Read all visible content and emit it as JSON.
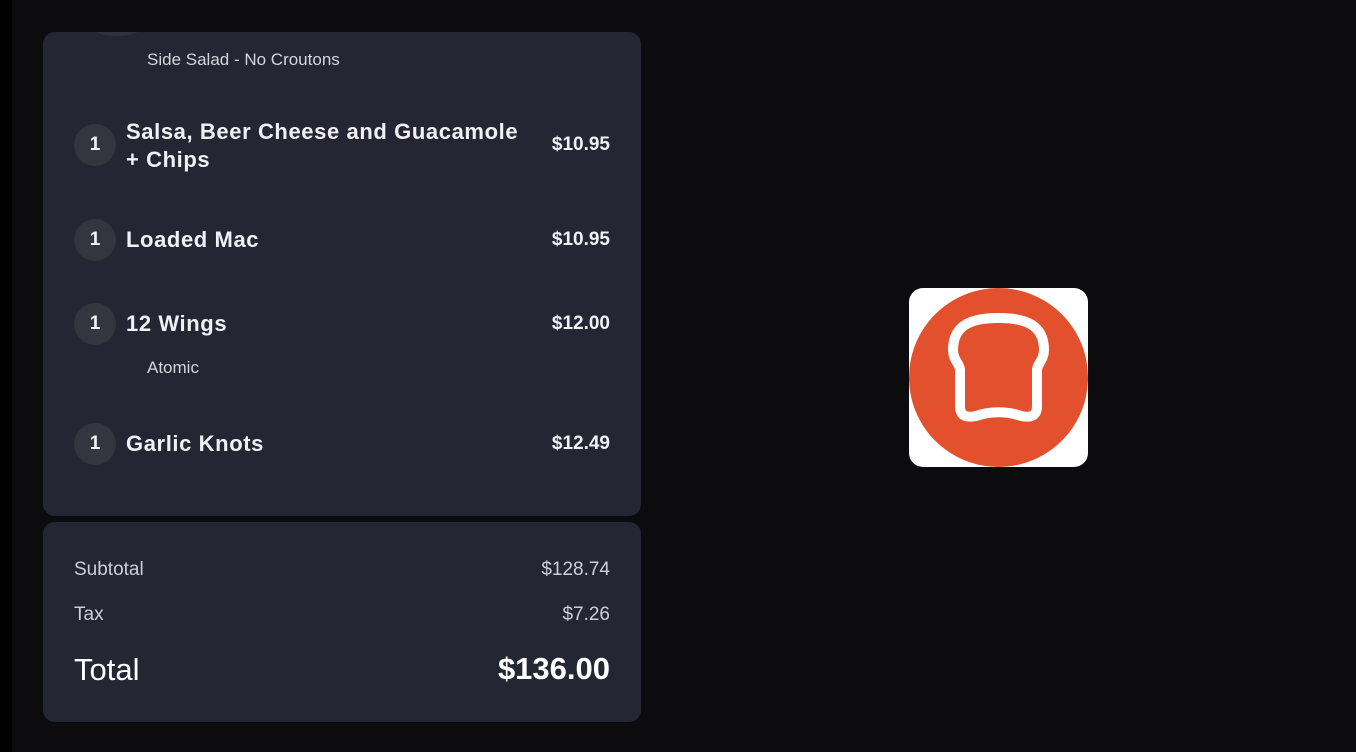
{
  "order": {
    "top_modifier": "Side Salad - No Croutons",
    "items": [
      {
        "qty": "1",
        "name_line1": "Salsa, Beer Cheese and Guacamole",
        "name_line2": "+ Chips",
        "price": "$10.95"
      },
      {
        "qty": "1",
        "name_line1": "Loaded Mac",
        "price": "$10.95"
      },
      {
        "qty": "1",
        "name_line1": "12 Wings",
        "price": "$12.00",
        "modifier": "Atomic"
      },
      {
        "qty": "1",
        "name_line1": "Garlic Knots",
        "price": "$12.49"
      }
    ]
  },
  "totals": {
    "subtotal_label": "Subtotal",
    "subtotal_value": "$128.74",
    "tax_label": "Tax",
    "tax_value": "$7.26",
    "total_label": "Total",
    "total_value": "$136.00"
  },
  "logo": {
    "icon": "toast-bread-logo-icon",
    "color": "#e2502d"
  },
  "colors": {
    "background": "#0c0c0e",
    "card": "#252633",
    "qty_badge": "#34353f",
    "brand": "#e2502d"
  }
}
